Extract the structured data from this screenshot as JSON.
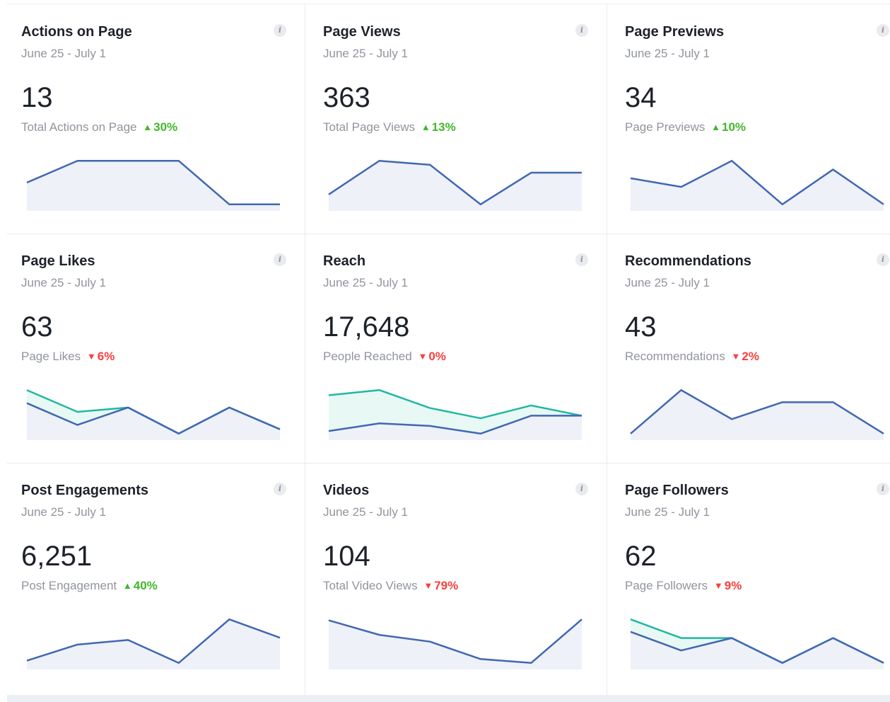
{
  "colors": {
    "line_primary": "#4267b2",
    "fill_primary": "#eef1f8",
    "line_secondary": "#21b8a0",
    "fill_secondary": "#e6f7f4",
    "up": "#42b72a",
    "down": "#fa3e3e"
  },
  "info_icon": "i",
  "cards": [
    {
      "title": "Actions on Page",
      "date": "June 25 - July 1",
      "value": "13",
      "metric": "Total Actions on Page",
      "delta": "30%",
      "direction": "up",
      "chart_data": {
        "type": "area",
        "series": [
          {
            "values": [
              30,
              45,
              45,
              45,
              15,
              15
            ]
          }
        ]
      }
    },
    {
      "title": "Page Views",
      "date": "June 25 - July 1",
      "value": "363",
      "metric": "Total Page Views",
      "delta": "13%",
      "direction": "up",
      "chart_data": {
        "type": "area",
        "series": [
          {
            "values": [
              55,
              72,
              70,
              50,
              66,
              66
            ]
          }
        ]
      }
    },
    {
      "title": "Page Previews",
      "date": "June 25 - July 1",
      "value": "34",
      "metric": "Page Previews",
      "delta": "10%",
      "direction": "up",
      "chart_data": {
        "type": "area",
        "series": [
          {
            "values": [
              7,
              6,
              9,
              4,
              8,
              4
            ]
          }
        ]
      }
    },
    {
      "title": "Page Likes",
      "date": "June 25 - July 1",
      "value": "63",
      "metric": "Page Likes",
      "delta": "6%",
      "direction": "down",
      "chart_data": {
        "type": "area",
        "series": [
          {
            "values": [
              13,
              8,
              12,
              6,
              12,
              7
            ]
          },
          {
            "values": [
              16,
              11,
              12,
              6,
              12,
              7
            ]
          }
        ]
      }
    },
    {
      "title": "Reach",
      "date": "June 25 - July 1",
      "value": "17,648",
      "metric": "People Reached",
      "delta": "0%",
      "direction": "down",
      "chart_data": {
        "type": "area",
        "series": [
          {
            "values": [
              1,
              4,
              3,
              0,
              7,
              7
            ]
          },
          {
            "values": [
              15,
              17,
              10,
              6,
              11,
              7
            ]
          }
        ]
      }
    },
    {
      "title": "Recommendations",
      "date": "June 25 - July 1",
      "value": "43",
      "metric": "Recommendations",
      "delta": "2%",
      "direction": "down",
      "chart_data": {
        "type": "area",
        "series": [
          {
            "values": [
              2,
              11,
              5,
              8.5,
              8.5,
              2
            ]
          }
        ]
      }
    },
    {
      "title": "Post Engagements",
      "date": "June 25 - July 1",
      "value": "6,251",
      "metric": "Post Engagement",
      "delta": "40%",
      "direction": "up",
      "chart_data": {
        "type": "area",
        "series": [
          {
            "values": [
              4,
              7.5,
              8.5,
              3.5,
              13,
              9
            ]
          }
        ]
      }
    },
    {
      "title": "Videos",
      "date": "June 25 - July 1",
      "value": "104",
      "metric": "Total Video Views",
      "delta": "79%",
      "direction": "down",
      "chart_data": {
        "type": "area",
        "series": [
          {
            "values": [
              70,
              55,
              48,
              30,
              26,
              71
            ]
          }
        ]
      }
    },
    {
      "title": "Page Followers",
      "date": "June 25 - July 1",
      "value": "62",
      "metric": "Page Followers",
      "delta": "9%",
      "direction": "down",
      "chart_data": {
        "type": "area",
        "series": [
          {
            "values": [
              9,
              6,
              8,
              4,
              8,
              4
            ]
          },
          {
            "values": [
              11,
              8,
              8,
              4,
              8,
              4
            ]
          }
        ]
      }
    }
  ]
}
